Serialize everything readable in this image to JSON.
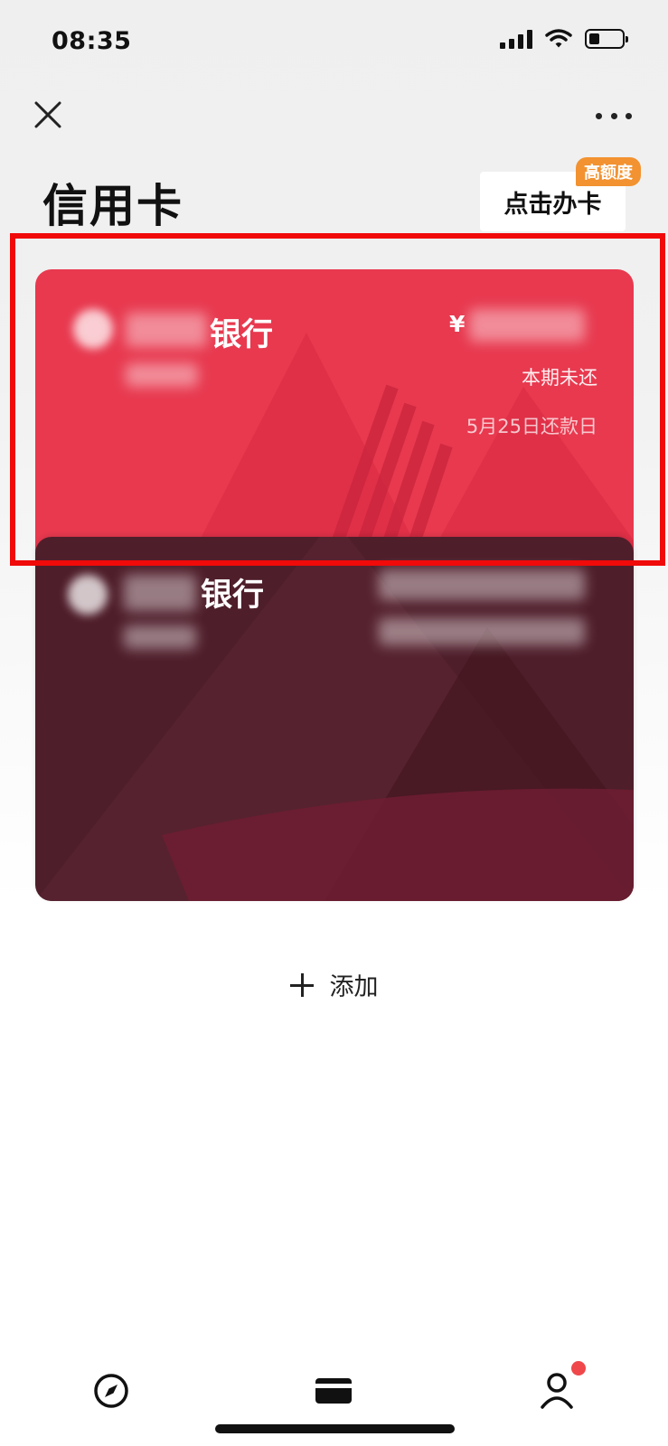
{
  "status_bar": {
    "time": "08:35"
  },
  "header": {
    "title": "信用卡"
  },
  "apply": {
    "label": "点击办卡",
    "badge": "高额度"
  },
  "cards": [
    {
      "bank_name": "银行",
      "currency": "¥",
      "status": "本期未还",
      "due": "5月25日还款日",
      "color": "#e8394f"
    },
    {
      "bank_name": "银行",
      "color": "#4f1e2b"
    }
  ],
  "add": {
    "label": "添加"
  },
  "tabbar": {
    "items": [
      "compass-icon",
      "card-icon",
      "user-icon"
    ],
    "active": "card-icon"
  },
  "colors": {
    "highlight": "#f00a0a",
    "badge": "#f29230",
    "notify": "#f0474b"
  }
}
